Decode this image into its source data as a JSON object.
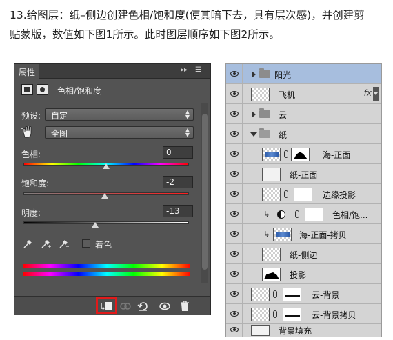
{
  "instruction": {
    "line1": "13.给图层：纸–侧边创建色相/饱和度(使其暗下去，具有层次感)，并创建剪",
    "line2": "贴蒙版，数值如下图1所示。此时图层顺序如下图2所示。"
  },
  "properties_panel": {
    "tab_label": "属性",
    "tab_controls": "▸▸",
    "menu_glyph": "☰",
    "adjustment_title": "色相/饱和度",
    "preset_label": "预设:",
    "preset_value": "自定",
    "channel_value": "全图",
    "hue_label": "色相:",
    "hue_value": "0",
    "saturation_label": "饱和度:",
    "saturation_value": "-2",
    "lightness_label": "明度:",
    "lightness_value": "-13",
    "hue_slider_fraction": 0.5,
    "saturation_slider_fraction": 0.49,
    "lightness_slider_fraction": 0.435,
    "colorize_label": "着色",
    "colorize_checked": false,
    "bottom_icons": [
      "clip-to-layer-icon",
      "view-previous-icon",
      "reset-icon",
      "visibility-icon",
      "trash-icon"
    ],
    "highlight_color": "#e11a1a"
  },
  "layers_panel": {
    "layers": [
      {
        "name": "阳光",
        "kind": "group-collapsed",
        "selected": true
      },
      {
        "name": "飞机",
        "kind": "layer",
        "fx": "fx"
      },
      {
        "name": "云",
        "kind": "group-collapsed"
      },
      {
        "name": "纸",
        "kind": "group-open"
      },
      {
        "name": "海-正面",
        "kind": "layer-mask"
      },
      {
        "name": "纸-正面",
        "kind": "layer"
      },
      {
        "name": "边缘投影",
        "kind": "layer-mask"
      },
      {
        "name": "色相/饱...",
        "kind": "adjustment-clipped"
      },
      {
        "name": "海-正面-拷贝",
        "kind": "layer-clipped"
      },
      {
        "name": "纸-侧边",
        "kind": "layer"
      },
      {
        "name": "投影",
        "kind": "layer"
      },
      {
        "name": "云-背景",
        "kind": "layer-mask"
      },
      {
        "name": "云-背景拷贝",
        "kind": "layer-mask"
      },
      {
        "name": "背景填充",
        "kind": "layer"
      }
    ]
  }
}
